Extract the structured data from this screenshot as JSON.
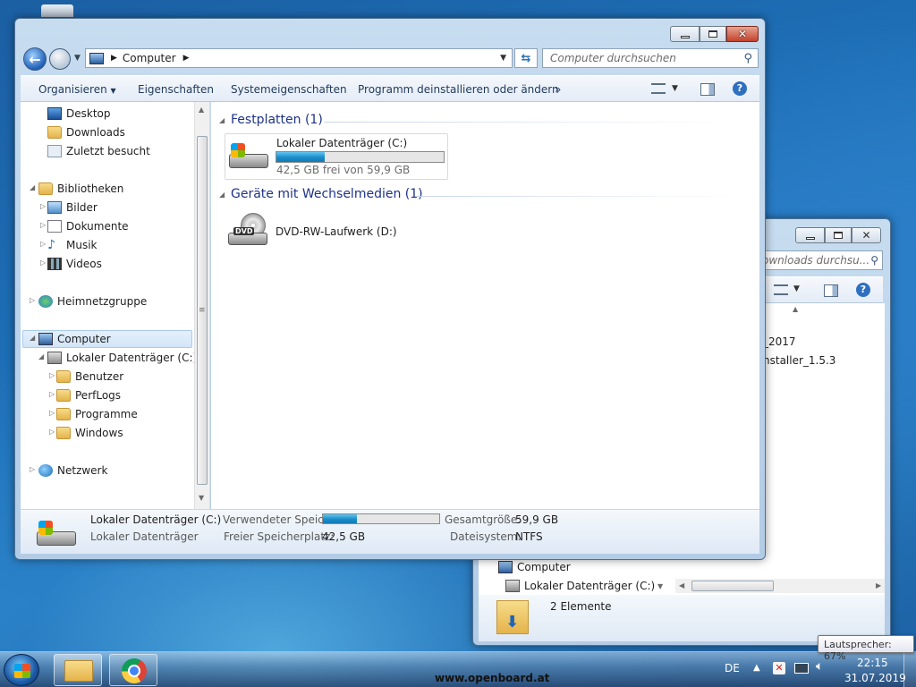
{
  "main_window": {
    "address_crumbs": [
      "Computer"
    ],
    "search_placeholder": "Computer durchsuchen",
    "toolbar": {
      "organize": "Organisieren",
      "properties": "Eigenschaften",
      "system_properties": "Systemeigenschaften",
      "uninstall": "Programm deinstallieren oder ändern",
      "more": "»"
    },
    "nav": {
      "favorites": [
        "Desktop",
        "Downloads",
        "Zuletzt besucht"
      ],
      "libraries": "Bibliotheken",
      "library_items": [
        "Bilder",
        "Dokumente",
        "Musik",
        "Videos"
      ],
      "homegroup": "Heimnetzgruppe",
      "computer": "Computer",
      "drive_c": "Lokaler Datenträger (C:)",
      "drive_c_children": [
        "Benutzer",
        "PerfLogs",
        "Programme",
        "Windows"
      ],
      "network": "Netzwerk"
    },
    "groups": {
      "hard_disks": "Festplatten (1)",
      "removable": "Geräte mit Wechselmedien (1)"
    },
    "drive_c": {
      "name": "Lokaler Datenträger (C:)",
      "free_text": "42,5 GB frei von 59,9 GB",
      "used_fraction": 0.29
    },
    "drive_d": {
      "name": "DVD-RW-Laufwerk (D:)",
      "icon_label": "DVD"
    },
    "details": {
      "name": "Lokaler Datenträger (C:)",
      "type": "Lokaler Datenträger",
      "used_label": "Verwendeter Speic...",
      "free_label": "Freier Speicherplatz:",
      "free_value": "42,5 GB",
      "total_label": "Gesamtgröße:",
      "total_value": "59,9 GB",
      "fs_label": "Dateisystem:",
      "fs_value": "NTFS",
      "used_fraction": 0.29
    }
  },
  "back_window": {
    "search_placeholder": "ownloads durchsu...",
    "items": [
      "_2017",
      "nstaller_1.5.3"
    ],
    "nav_computer": "Computer",
    "nav_drive": "Lokaler Datenträger (C:)",
    "status": "2 Elemente"
  },
  "taskbar": {
    "language": "DE",
    "time": "22:15",
    "date": "31.07.2019",
    "watermark": "www.openboard.at",
    "tooltip": "Lautsprecher: 67%"
  },
  "colors": {
    "accent_blue": "#1e3287",
    "progress": "#26a0da",
    "close_red": "#c3422c"
  }
}
